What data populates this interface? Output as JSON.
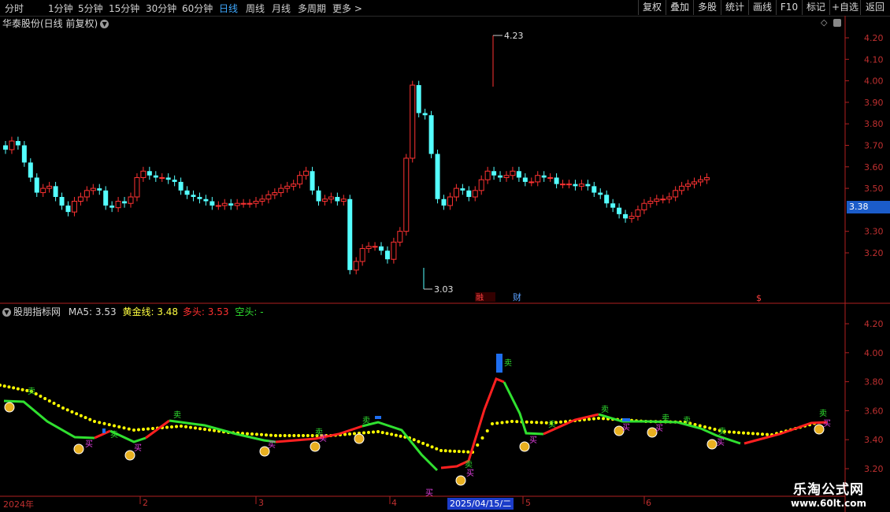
{
  "toolbar": {
    "periods": [
      "分时",
      "1分钟",
      "5分钟",
      "15分钟",
      "30分钟",
      "60分钟",
      "日线",
      "周线",
      "月线",
      "多周期",
      "更多 >"
    ],
    "active_period": "日线",
    "right_buttons": [
      "复权",
      "叠加",
      "多股",
      "统计",
      "画线",
      "F10",
      "标记",
      "+自选",
      "返回"
    ]
  },
  "main_chart": {
    "title": "华泰股份(日线 前复权)",
    "high_label": "4.23",
    "low_label": "3.03",
    "current_price_tag": "3.38",
    "y_ticks": [
      "4.20",
      "4.10",
      "4.00",
      "3.90",
      "3.80",
      "3.70",
      "3.60",
      "3.50",
      "3.30",
      "3.20"
    ],
    "markers": [
      "融",
      "财"
    ],
    "dollar_marker": "$"
  },
  "indicator": {
    "name": "股朋指标网",
    "ma5_label": "MA5:",
    "ma5_value": "3.53",
    "gold_label": "黄金线:",
    "gold_value": "3.48",
    "long_label": "多头:",
    "long_value": "3.53",
    "short_label": "空头:",
    "short_value": "-",
    "y_ticks": [
      "4.20",
      "4.00",
      "3.80",
      "3.60",
      "3.40",
      "3.20"
    ],
    "buy_label": "买",
    "sell_label": "卖"
  },
  "x_axis": {
    "labels": [
      "2024年",
      "2",
      "3",
      "4",
      "5",
      "6"
    ],
    "highlight_date": "2025/04/15/二"
  },
  "watermark": {
    "title": "乐淘公式网",
    "url": "www.60lt.com"
  },
  "colors": {
    "up": "#ff3232",
    "down": "#54ffff",
    "long_line": "#ff2020",
    "short_line": "#30e030",
    "gold_line": "#ffff00",
    "axis": "#b02020"
  }
}
